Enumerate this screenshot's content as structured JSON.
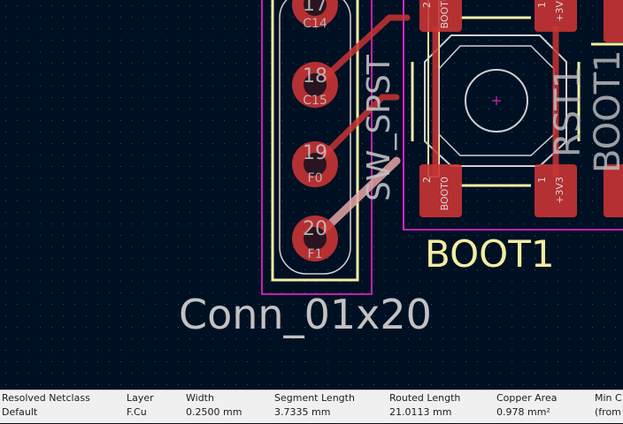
{
  "board": {
    "connector_label": "Conn_01x20",
    "button_label": "BOOT1",
    "pads": [
      {
        "number": "17",
        "net": "C14"
      },
      {
        "number": "18",
        "net": "C15"
      },
      {
        "number": "19",
        "net": "F0"
      },
      {
        "number": "20",
        "net": "F1"
      }
    ],
    "silk_vertical_1": "SW_SPST",
    "silk_vertical_2": "RST1",
    "silk_vertical_3": "BOOT1",
    "smd_pads": [
      {
        "number": "2",
        "net": "BOOT0"
      },
      {
        "number": "1",
        "net": "+3V3"
      },
      {
        "number": "2",
        "net": "BOOT0"
      },
      {
        "number": "1",
        "net": "+3V3"
      }
    ],
    "colors": {
      "background": "#001023",
      "silkscreen": "#f2eda1",
      "copper": "#c83434",
      "courtyard": "#ff26e2",
      "fab_text": "#c2c2c2"
    }
  },
  "status": {
    "fields": [
      {
        "label": "Resolved Netclass",
        "value": "Default"
      },
      {
        "label": "Layer",
        "value": "F.Cu"
      },
      {
        "label": "Width",
        "value": "0.2500 mm"
      },
      {
        "label": "Segment Length",
        "value": "3.7335 mm"
      },
      {
        "label": "Routed Length",
        "value": "21.0113 mm"
      },
      {
        "label": "Copper Area",
        "value": "0.978 mm²"
      },
      {
        "label": "Min C",
        "value": "(from"
      }
    ]
  }
}
